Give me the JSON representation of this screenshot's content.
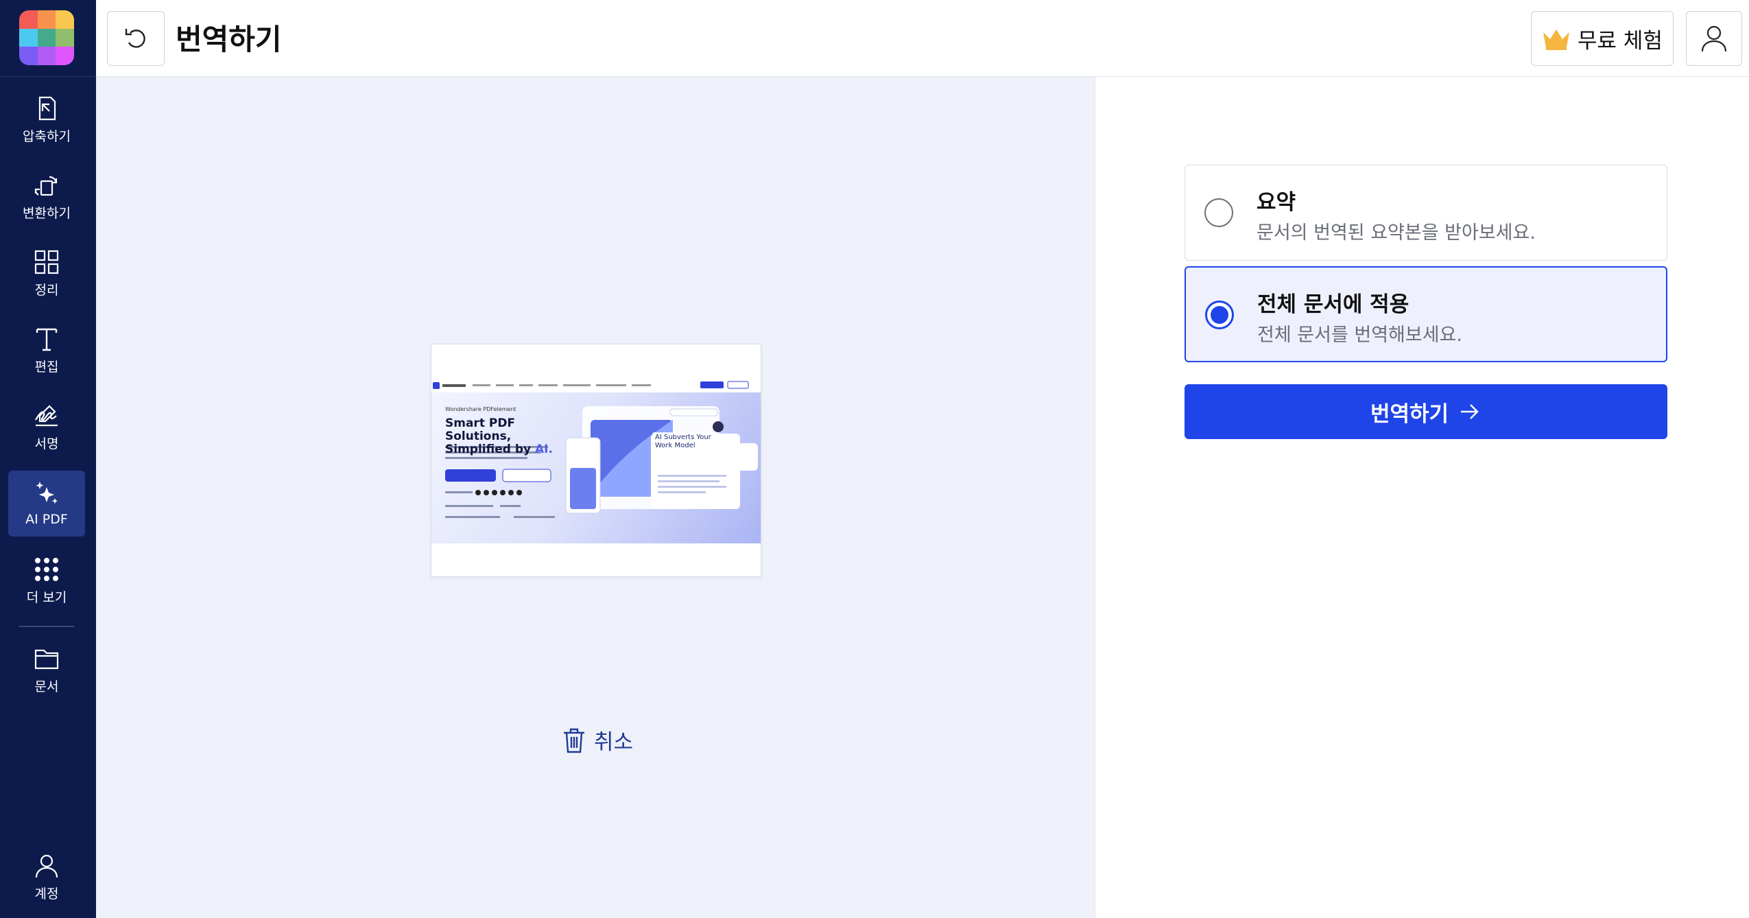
{
  "sidebar": {
    "logo_colors": [
      "#f25c54",
      "#f7934c",
      "#f9c74f",
      "#4cc9f0",
      "#43aa8b",
      "#90be6d",
      "#7b5cf5",
      "#b15cf5",
      "#e056fd"
    ],
    "items": [
      {
        "label": "압축하기",
        "icon": "compress-icon"
      },
      {
        "label": "변환하기",
        "icon": "convert-icon"
      },
      {
        "label": "정리",
        "icon": "organize-grid-icon"
      },
      {
        "label": "편집",
        "icon": "text-edit-icon"
      },
      {
        "label": "서명",
        "icon": "signature-icon"
      },
      {
        "label": "AI PDF",
        "icon": "sparkle-ai-icon"
      },
      {
        "label": "더 보기",
        "icon": "more-grid-icon"
      },
      {
        "label": "문서",
        "icon": "folder-icon"
      },
      {
        "label": "계정",
        "icon": "user-icon"
      }
    ],
    "active_item": "AI PDF"
  },
  "header": {
    "title": "번역하기",
    "back_icon": "undo-icon",
    "trial_label": "무료 체험",
    "trial_icon": "crown-icon",
    "account_icon": "user-icon"
  },
  "preview": {
    "thumbnail": {
      "brand": "Wondershare PDFelement",
      "headline_line1": "Smart PDF Solutions,",
      "headline_line2": "Simplified by",
      "headline_ai": "AI.",
      "card_text": "AI Subverts Your\nWork Model"
    },
    "cancel_label": "취소",
    "cancel_icon": "trash-icon"
  },
  "options": [
    {
      "title": "요약",
      "description": "문서의 번역된 요약본을 받아보세요.",
      "selected": false
    },
    {
      "title": "전체 문서에 적용",
      "description": "전체 문서를 번역해보세요.",
      "selected": true
    }
  ],
  "action": {
    "label": "번역하기",
    "icon": "arrow-right-icon"
  },
  "colors": {
    "sidebar_bg": "#0d1b4c",
    "sidebar_active": "#243a86",
    "accent": "#1f45e8",
    "preview_bg": "#eef1fa",
    "crown": "#f4b63f"
  }
}
